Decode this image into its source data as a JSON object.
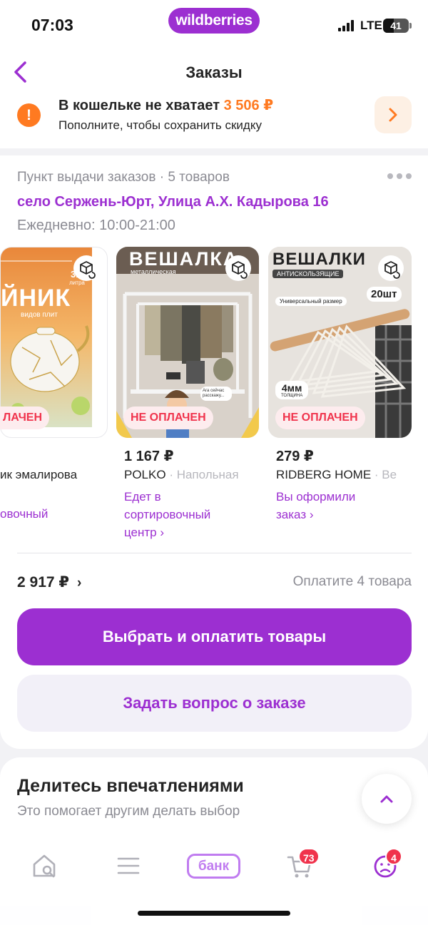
{
  "status_bar": {
    "time": "07:03",
    "network": "LTE",
    "battery": "41",
    "battery_level": 0.41
  },
  "brand": {
    "name": "wildberries",
    "color": "#9c2fd1"
  },
  "header": {
    "title": "Заказы",
    "back_icon": "chevron-left-icon"
  },
  "wallet_alert": {
    "title_prefix": "В кошельке не хватает",
    "amount": "3 506 ₽",
    "subtitle": "Пополните, чтобы сохранить скидку",
    "icon": "exclamation-icon",
    "accent_color": "#ff7a21"
  },
  "order": {
    "pickup_label": "Пункт выдачи заказов · 5 товаров",
    "address": "село Сержень-Юрт, Улица А.Х. Кадырова 16",
    "hours": "Ежедневно: 10:00-21:00",
    "products": [
      {
        "image_text": "ЙНИК",
        "image_sub": "видов плит",
        "image_tag": "3.5",
        "image_tag_sub": "литра",
        "badge": "ЛАЧЕН",
        "name": "ик эмалирова",
        "status": "овочный"
      },
      {
        "image_text": "ВЕШАЛКА",
        "image_sub": "металлическая",
        "image_bubble": "Ага сейчас расскажу...",
        "badge": "НЕ ОПЛАЧЕН",
        "price": "1 167 ₽",
        "name_brand": "POLKO",
        "name_rest": " · Напольная",
        "status": "Едет в сортировочный центр ›"
      },
      {
        "image_text": "ВЕШАЛКИ",
        "image_sub": "АНТИСКОЛЬЗЯЩИЕ",
        "image_tag": "20шт",
        "image_note": "Универсальный размер",
        "image_thick": "4мм",
        "image_thick_sub": "ТОЛЩИНА",
        "badge": "НЕ ОПЛАЧЕН",
        "price": "279 ₽",
        "name_brand": "RIDBERG HOME",
        "name_rest": " · Ве",
        "status": "Вы оформили заказ ›"
      }
    ],
    "total": "2 917 ₽",
    "pay_hint": "Оплатите 4 товара",
    "pay_button": "Выбрать и оплатить товары",
    "ask_button": "Задать вопрос о заказе"
  },
  "reviews": {
    "title": "Делитесь впечатлениями",
    "subtitle": "Это помогает другим делать выбор"
  },
  "bottom_nav": {
    "home_icon": "home-search-icon",
    "catalog_icon": "menu-icon",
    "bank_label": "банк",
    "cart_icon": "cart-icon",
    "cart_count": "73",
    "profile_icon": "profile-icon",
    "profile_count": "4"
  },
  "colors": {
    "purple": "#9c2fd1",
    "orange": "#ff7a21",
    "red": "#f0334c",
    "gray_text": "#8b8b93"
  }
}
